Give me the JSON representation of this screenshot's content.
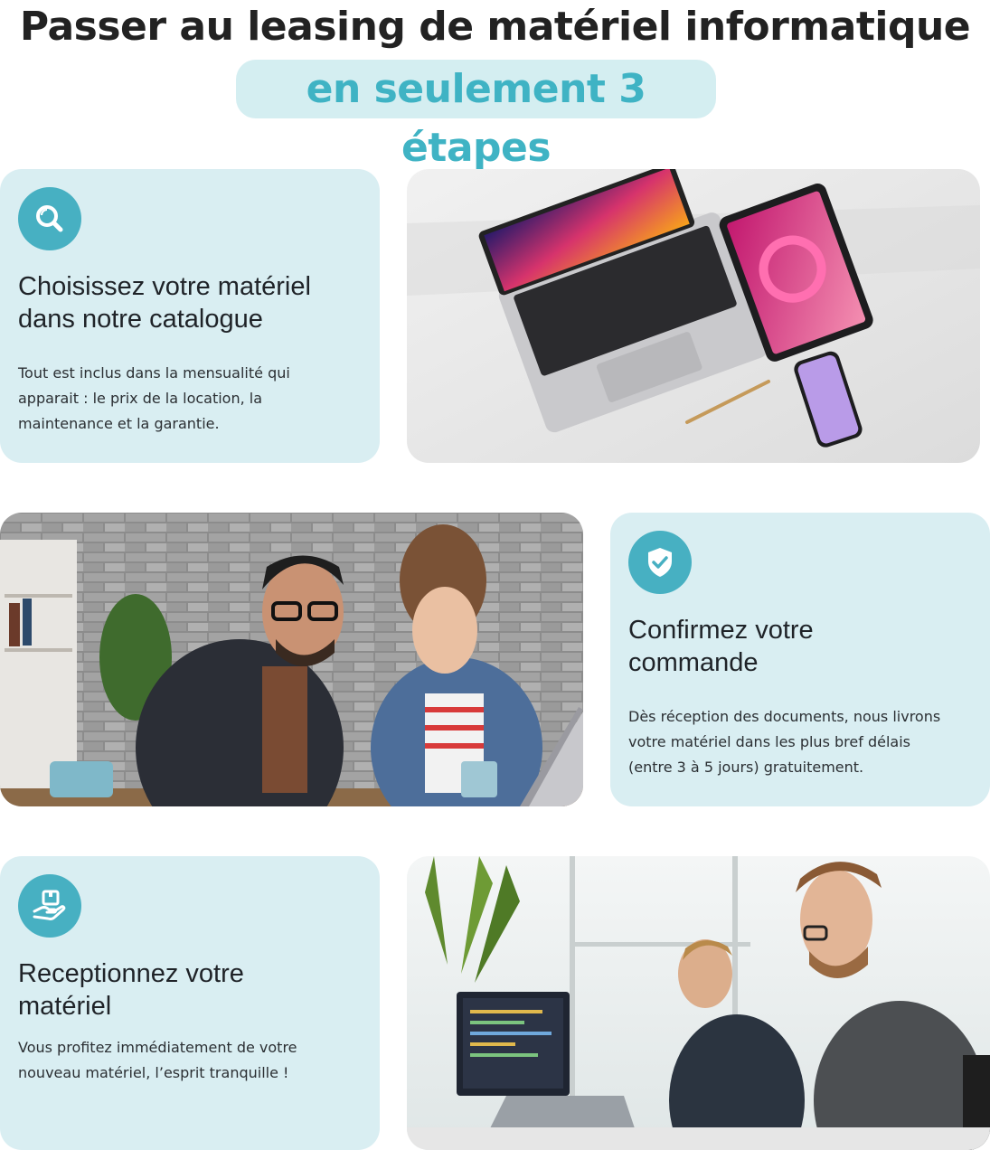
{
  "hero": {
    "title": "Passer au leasing de matériel informatique",
    "highlight": "en seulement 3 étapes"
  },
  "colors": {
    "accent": "#47b0c2",
    "highlight_text": "#3fb3c4",
    "card_bg": "#d9eef2",
    "highlight_bg": "#d4eef1"
  },
  "steps": [
    {
      "icon": "search-icon",
      "title_line1": "Choisissez votre matériel",
      "title_line2": "dans notre catalogue",
      "text_line1": "Tout est inclus dans la mensualité qui",
      "text_line2": "apparait : le prix de la location, la",
      "text_line3": "maintenance et la garantie."
    },
    {
      "icon": "shield-check-icon",
      "title_line1": "Confirmez votre",
      "title_line2": "commande",
      "text_line1": "Dès réception des documents, nous livrons",
      "text_line2": "votre matériel dans les plus bref délais",
      "text_line3": "(entre 3 à 5 jours) gratuitement."
    },
    {
      "icon": "hand-box-icon",
      "title_line1": "Receptionnez votre",
      "title_line2": "matériel",
      "text_line1": "Vous profitez immédiatement de votre",
      "text_line2": "nouveau matériel, l’esprit tranquille !"
    }
  ],
  "images": [
    {
      "name": "devices-photo"
    },
    {
      "name": "coworkers-laptop-photo"
    },
    {
      "name": "office-developers-photo"
    }
  ]
}
